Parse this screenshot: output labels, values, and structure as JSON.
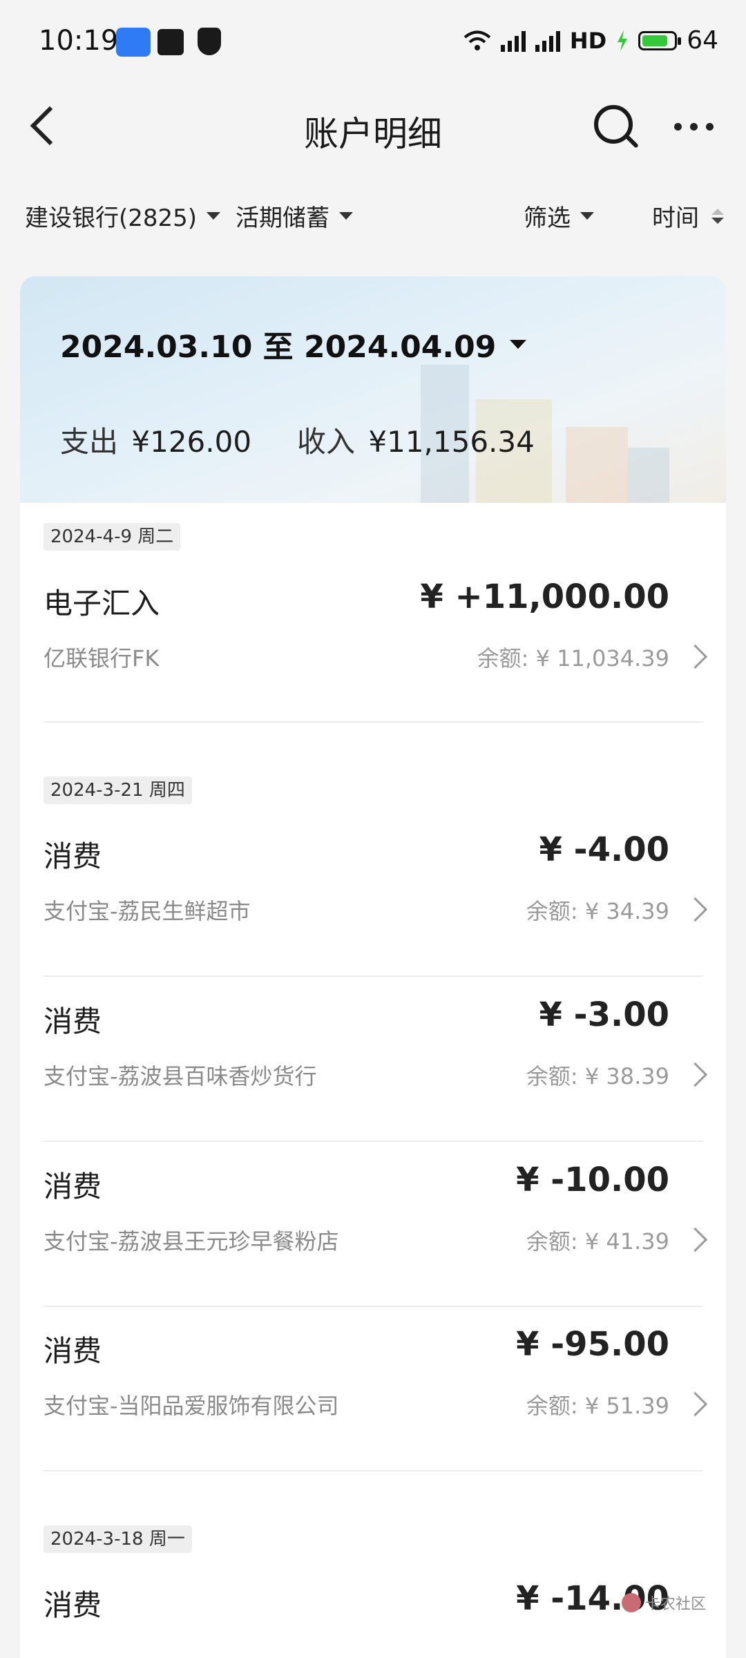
{
  "status_bar": {
    "time": "10:19",
    "network_label": "HD",
    "battery": "64",
    "icons": [
      "location-app-icon",
      "alipay-icon",
      "shield-yuan-icon",
      "wifi-icon",
      "signal-5g-icon",
      "signal-5g-icon",
      "hd-icon",
      "charging-icon",
      "battery-icon"
    ]
  },
  "header": {
    "title": "账户明细",
    "back_icon": "chevron-left-icon",
    "search_icon": "search-icon",
    "more_icon": "more-horizontal-icon"
  },
  "filters": {
    "account": "建设银行(2825)",
    "account_type": "活期储蓄",
    "filter": "筛选",
    "sort": "时间"
  },
  "summary": {
    "date_range": "2024.03.10 至 2024.04.09",
    "expense_label": "支出",
    "expense_value": "¥126.00",
    "income_label": "收入",
    "income_value": "¥11,156.34"
  },
  "groups": [
    {
      "date": "2024-4-9 周二",
      "items": [
        {
          "type": "电子汇入",
          "desc": "亿联银行FK",
          "amount": "¥ +11,000.00",
          "balance": "余额: ¥ 11,034.39"
        }
      ]
    },
    {
      "date": "2024-3-21 周四",
      "items": [
        {
          "type": "消费",
          "desc": "支付宝-荔民生鲜超市",
          "amount": "¥ -4.00",
          "balance": "余额: ¥ 34.39"
        },
        {
          "type": "消费",
          "desc": "支付宝-荔波县百味香炒货行",
          "amount": "¥ -3.00",
          "balance": "余额: ¥ 38.39"
        },
        {
          "type": "消费",
          "desc": "支付宝-荔波县王元珍早餐粉店",
          "amount": "¥ -10.00",
          "balance": "余额: ¥ 41.39"
        },
        {
          "type": "消费",
          "desc": "支付宝-当阳品爱服饰有限公司",
          "amount": "¥ -95.00",
          "balance": "余额: ¥ 51.39"
        }
      ]
    },
    {
      "date": "2024-3-18 周一",
      "items": [
        {
          "type": "消费",
          "amount": "¥ -14.00"
        }
      ]
    }
  ],
  "watermark": "卡农社区"
}
